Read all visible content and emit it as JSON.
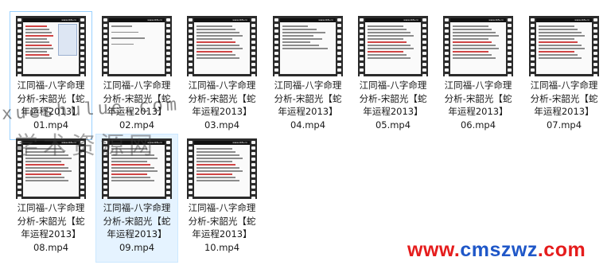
{
  "files": [
    {
      "name": "江同福-八字命理\n分析-宋韶光【蛇\n年运程2013】\n01.mp4",
      "state": "selected-focus",
      "thumb": "desktop"
    },
    {
      "name": "江同福-八字命理\n分析-宋韶光【蛇\n年运程2013】\n02.mp4",
      "state": "normal",
      "thumb": "sparse"
    },
    {
      "name": "江同福-八字命理\n分析-宋韶光【蛇\n年运程2013】\n03.mp4",
      "state": "normal",
      "thumb": "table"
    },
    {
      "name": "江同福-八字命理\n分析-宋韶光【蛇\n年运程2013】\n04.mp4",
      "state": "normal",
      "thumb": "text"
    },
    {
      "name": "江同福-八字命理\n分析-宋韶光【蛇\n年运程2013】\n05.mp4",
      "state": "normal",
      "thumb": "table"
    },
    {
      "name": "江同福-八字命理\n分析-宋韶光【蛇\n年运程2013】\n06.mp4",
      "state": "normal",
      "thumb": "table"
    },
    {
      "name": "江同福-八字命理\n分析-宋韶光【蛇\n年运程2013】\n07.mp4",
      "state": "normal",
      "thumb": "table"
    },
    {
      "name": "江同福-八字命理\n分析-宋韶光【蛇\n年运程2013】\n08.mp4",
      "state": "normal",
      "thumb": "table"
    },
    {
      "name": "江同福-八字命理\n分析-宋韶光【蛇\n年运程2013】\n09.mp4",
      "state": "selected",
      "thumb": "table"
    },
    {
      "name": "江同福-八字命理\n分析-宋韶光【蛇\n年运程2013】\n10.mp4",
      "state": "normal",
      "thumb": "table"
    }
  ],
  "thumb_site_text": "www.zbfs.cn",
  "watermark": {
    "line1": "xueshulue.com",
    "line2": "学术资源网"
  },
  "site_logo": {
    "prefix": "www.",
    "brand": "cmszwz",
    "suffix": ".com"
  },
  "colors": {
    "selected_bg": "#e5f3ff",
    "selected_border": "#cce8ff",
    "logo_red": "#e51c1c",
    "logo_blue": "#1f57c8"
  }
}
